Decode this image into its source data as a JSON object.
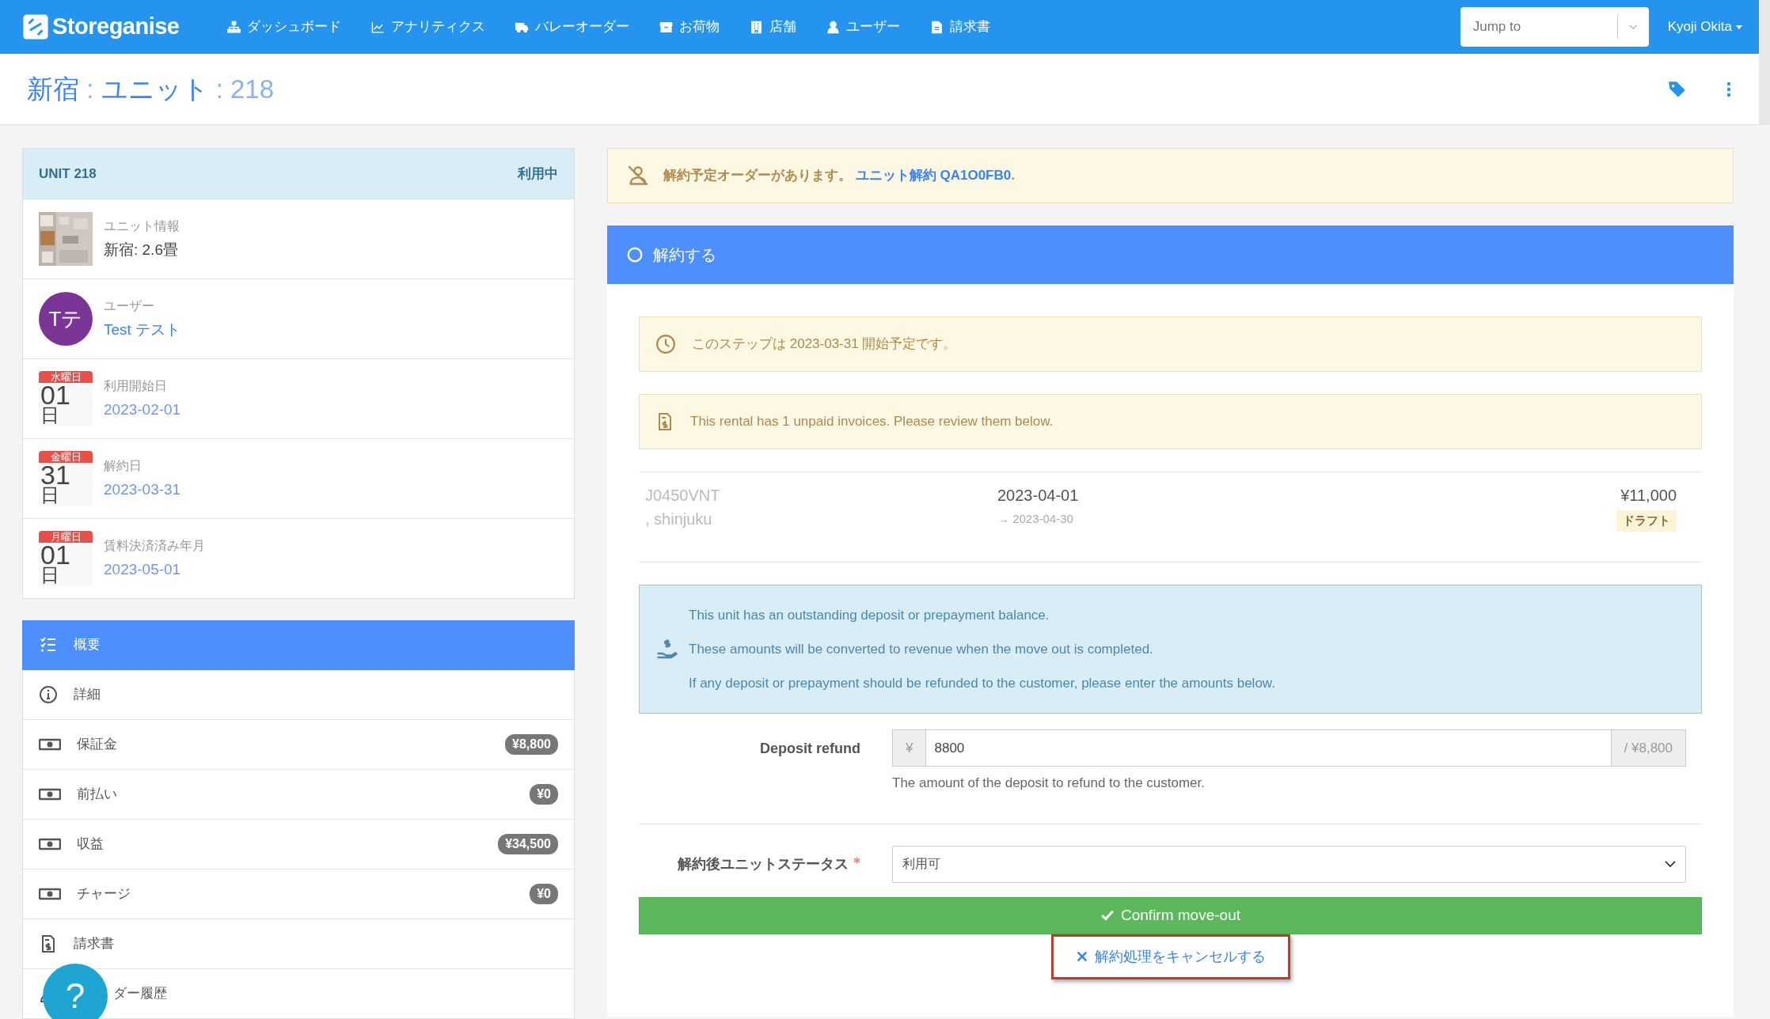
{
  "navbar": {
    "brand": "Storeganise",
    "items": [
      {
        "label": "ダッシュボード"
      },
      {
        "label": "アナリティクス"
      },
      {
        "label": "バレーオーダー"
      },
      {
        "label": "お荷物"
      },
      {
        "label": "店舗"
      },
      {
        "label": "ユーザー"
      },
      {
        "label": "請求書"
      }
    ],
    "jump": {
      "placeholder": "Jump to"
    },
    "user": "Kyoji Okita"
  },
  "header": {
    "title": [
      {
        "text": "新宿",
        "kind": "link"
      },
      {
        "text": " : ",
        "kind": "sep"
      },
      {
        "text": "ユニット",
        "kind": "link"
      },
      {
        "text": " : 218",
        "kind": "sep"
      }
    ]
  },
  "unit_card": {
    "title": "UNIT 218",
    "status": "利用中",
    "rows": [
      {
        "kind": "picture",
        "label": "ユニット情報",
        "value": "新宿: 2.6畳"
      },
      {
        "kind": "avatar",
        "initials": "Tテ",
        "color": "#7b3596",
        "label": "ユーザー",
        "value": "Test テスト"
      },
      {
        "kind": "date",
        "weekday": "水曜日",
        "day": "01",
        "day_suffix": "日",
        "label": "利用開始日",
        "value": "2023-02-01"
      },
      {
        "kind": "date",
        "weekday": "金曜日",
        "day": "31",
        "day_suffix": "日",
        "label": "解約日",
        "value": "2023-03-31"
      },
      {
        "kind": "date",
        "weekday": "月曜日",
        "day": "01",
        "day_suffix": "日",
        "label": "賃料決済済み年月",
        "value": "2023-05-01"
      }
    ]
  },
  "menu": [
    {
      "label": "概要",
      "selected": true
    },
    {
      "label": "詳細",
      "selected": false
    },
    {
      "label": "保証金",
      "selected": false,
      "badge": "¥8,800"
    },
    {
      "label": "前払い",
      "selected": false,
      "badge": "¥0"
    },
    {
      "label": "収益",
      "selected": false,
      "badge": "¥34,500"
    },
    {
      "label": "チャージ",
      "selected": false,
      "badge": "¥0"
    },
    {
      "label": "請求書",
      "selected": false
    },
    {
      "label": "ダー履歴",
      "selected": false
    }
  ],
  "alert": {
    "text": "解約予定オーダーがあります。 ",
    "link": "ユニット解約 QA1O0FB0",
    "tail": "."
  },
  "step": {
    "title": "解約する",
    "notice": "このステップは 2023-03-31 開始予定です。",
    "invoice_warning": "This rental has 1 unpaid invoices. Please review them below.",
    "invoice": {
      "code": "J0450VNT",
      "location": ", shinjuku",
      "date": "2023-04-01",
      "end": "→ 2023-04-30",
      "amount": "¥11,000",
      "status": "ドラフト"
    },
    "info": [
      "This unit has an outstanding deposit or prepayment balance.",
      "These amounts will be converted to revenue when the move out is completed.",
      "If any deposit or prepayment should be refunded to the customer, please enter the amounts below."
    ],
    "deposit": {
      "label": "Deposit refund",
      "prefix": "¥",
      "value": "8800",
      "suffix": "/ ¥8,800",
      "help": "The amount of the deposit to refund to the customer."
    },
    "status_field": {
      "label": "解約後ユニットステータス",
      "required": true,
      "value": "利用可"
    },
    "confirm": "Confirm move-out",
    "cancel": "解約処理をキャンセルする"
  },
  "help": "?"
}
